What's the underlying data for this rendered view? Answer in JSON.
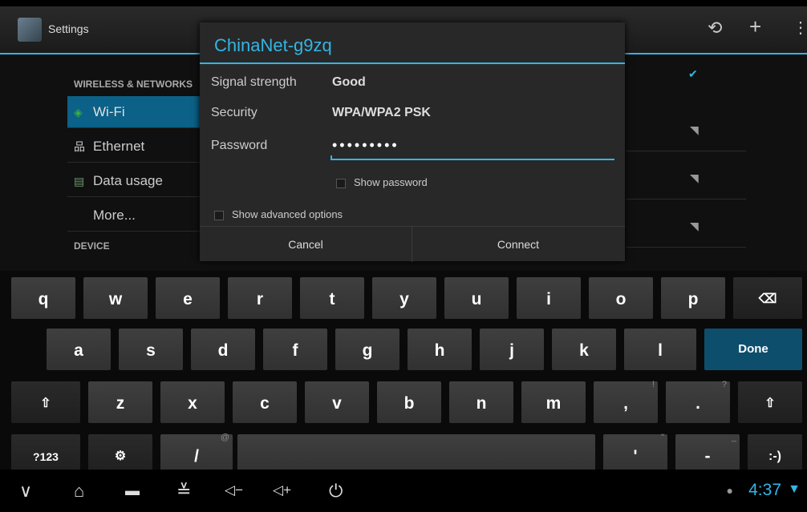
{
  "topbar": {
    "title": "Settings"
  },
  "nav": {
    "header_wireless": "WIRELESS & NETWORKS",
    "items": [
      "Wi-Fi",
      "Ethernet",
      "Data usage",
      "More..."
    ],
    "header_device": "DEVICE"
  },
  "dialog": {
    "title": "ChinaNet-g9zq",
    "signal_label": "Signal strength",
    "signal_value": "Good",
    "security_label": "Security",
    "security_value": "WPA/WPA2 PSK",
    "password_label": "Password",
    "password_value": "•••••••••",
    "show_password": "Show password",
    "show_advanced": "Show advanced options",
    "cancel": "Cancel",
    "connect": "Connect"
  },
  "keyboard": {
    "row1": [
      "q",
      "w",
      "e",
      "r",
      "t",
      "y",
      "u",
      "i",
      "o",
      "p"
    ],
    "row2": [
      "a",
      "s",
      "d",
      "f",
      "g",
      "h",
      "j",
      "k",
      "l"
    ],
    "row3": [
      "z",
      "x",
      "c",
      "v",
      "b",
      "n",
      "m",
      ",",
      "."
    ],
    "row3_hints": [
      "!",
      "?"
    ],
    "done": "Done",
    "sym": "?123",
    "slash": "/",
    "slash_hint": "@",
    "apostrophe": "'",
    "apostrophe_hint": "\"",
    "dash": "-",
    "dash_hint": "_",
    "smiley": ":-)"
  },
  "statusbar": {
    "time": "4:37"
  },
  "icons": {
    "shift": "shift-icon",
    "backspace": "backspace-icon",
    "settings_key": "keyboard-settings-icon",
    "back": "back-icon",
    "home": "home-icon",
    "recent": "recent-apps-icon",
    "hide_keyboard": "hide-keyboard-icon",
    "vol_down": "volume-down-icon",
    "vol_up": "volume-up-icon",
    "power": "power-icon"
  },
  "colors": {
    "accent": "#33b5e5",
    "selected": "#0b6187",
    "done_key": "#0e4e6d"
  }
}
